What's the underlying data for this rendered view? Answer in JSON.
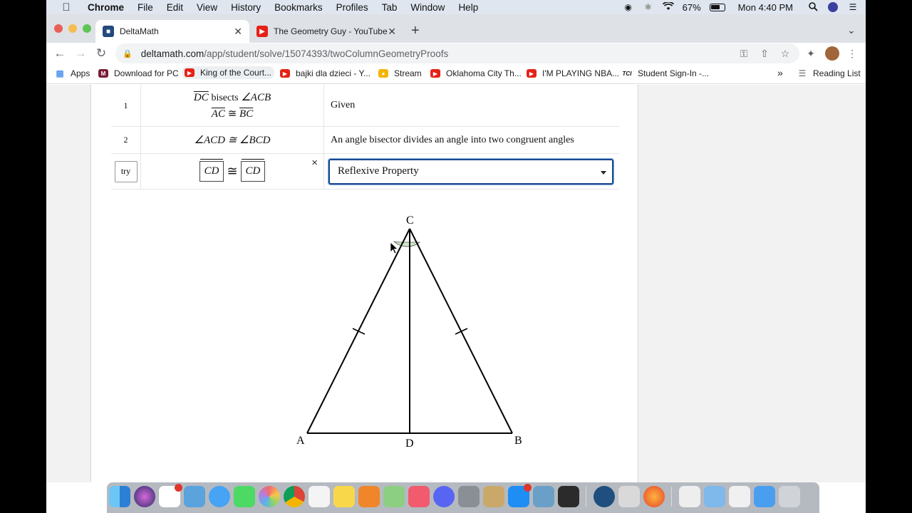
{
  "menubar": {
    "apple_icon": "apple-icon",
    "items": [
      "Chrome",
      "File",
      "Edit",
      "View",
      "History",
      "Bookmarks",
      "Profiles",
      "Tab",
      "Window",
      "Help"
    ],
    "battery": "67%",
    "clock": "Mon 4:40 PM"
  },
  "tabs": [
    {
      "title": "DeltaMath",
      "active": true
    },
    {
      "title": "The Geometry Guy - YouTube",
      "active": false
    }
  ],
  "address": {
    "host": "deltamath.com",
    "path": "/app/student/solve/15074393/twoColumnGeometryProofs"
  },
  "bookmarks": {
    "items": [
      "Apps",
      "Download for PC",
      "King of the Court...",
      "bajki dla dzieci - Y...",
      "Stream",
      "Oklahoma City Th...",
      "I'M PLAYING NBA...",
      "Student Sign-In -..."
    ],
    "overflow": "»",
    "reading_list": "Reading List"
  },
  "proof": {
    "rows": [
      {
        "num": "1",
        "stmt_line1_seg": "DC",
        "stmt_line1_word": "bisects",
        "stmt_line1_angle": "∠ACB",
        "stmt_line2_a": "AC",
        "stmt_line2_op": "≅",
        "stmt_line2_b": "BC",
        "reason": "Given"
      },
      {
        "num": "2",
        "stmt": "∠ACD ≅ ∠BCD",
        "reason": "An angle bisector divides an angle into two congruent angles"
      }
    ],
    "entry": {
      "try_label": "try",
      "seg_a": "CD",
      "op": "≅",
      "seg_b": "CD",
      "remove": "×",
      "reason_selected": "Reflexive Property"
    }
  },
  "diagram": {
    "labels": {
      "top": "C",
      "left": "A",
      "right": "B",
      "bottom": "D"
    }
  }
}
